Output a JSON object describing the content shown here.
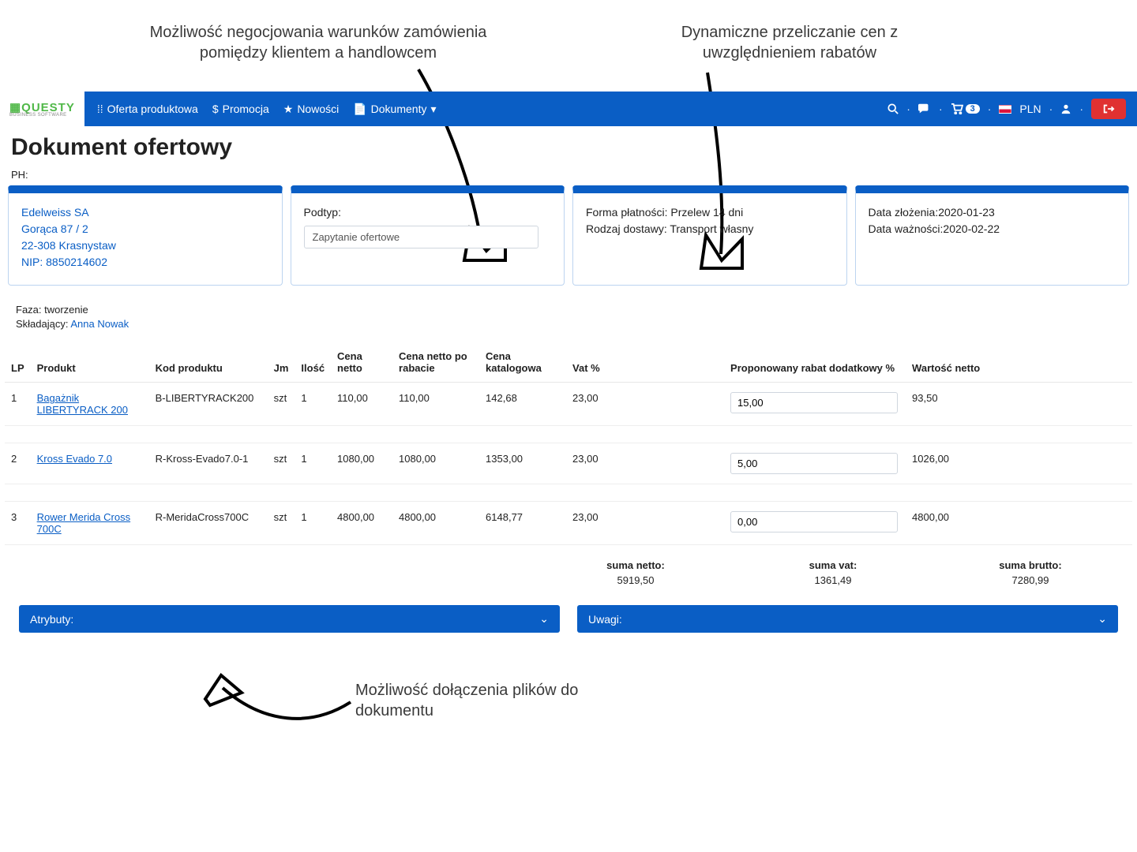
{
  "annotations": {
    "top_left": "Możliwość negocjowania warunków zamówienia pomiędzy klientem a handlowcem",
    "top_right": "Dynamiczne przeliczanie cen z uwzględnieniem rabatów",
    "bottom": "Możliwość dołączenia plików do dokumentu"
  },
  "nav": {
    "offer": "Oferta produktowa",
    "promo": "Promocja",
    "news": "Nowości",
    "docs": "Dokumenty",
    "cart_count": "3",
    "currency": "PLN"
  },
  "page": {
    "title": "Dokument ofertowy",
    "ph_label": "PH:"
  },
  "client": {
    "name": "Edelweiss SA",
    "street": "Gorąca 87 / 2",
    "city": "22-308 Krasnystaw",
    "nip_label": "NIP: 8850214602"
  },
  "subtype": {
    "label": "Podtyp:",
    "value": "Zapytanie ofertowe"
  },
  "payment": {
    "line1": "Forma płatności: Przelew 14 dni",
    "line2": "Rodzaj dostawy: Transport własny"
  },
  "dates": {
    "line1": "Data złożenia:2020-01-23",
    "line2": "Data ważności:2020-02-22"
  },
  "meta": {
    "phase": "Faza: tworzenie",
    "submitter_label": "Składający: ",
    "submitter": "Anna Nowak"
  },
  "headers": {
    "lp": "LP",
    "produkt": "Produkt",
    "kod": "Kod produktu",
    "jm": "Jm",
    "ilosc": "Ilość",
    "cena_netto": "Cena netto",
    "cena_rabat": "Cena netto po rabacie",
    "cena_kat": "Cena katalogowa",
    "vat": "Vat %",
    "prop_rabat": "Proponowany rabat dodatkowy %",
    "wartosc": "Wartość netto"
  },
  "rows": [
    {
      "lp": "1",
      "produkt": "Bagażnik LIBERTYRACK 200",
      "kod": "B-LIBERTYRACK200",
      "jm": "szt",
      "ilosc": "1",
      "cena_netto": "110,00",
      "cena_rabat": "110,00",
      "cena_kat": "142,68",
      "vat": "23,00",
      "rabat": "15,00",
      "wartosc": "93,50"
    },
    {
      "lp": "2",
      "produkt": "Kross Evado 7.0",
      "kod": "R-Kross-Evado7.0-1",
      "jm": "szt",
      "ilosc": "1",
      "cena_netto": "1080,00",
      "cena_rabat": "1080,00",
      "cena_kat": "1353,00",
      "vat": "23,00",
      "rabat": "5,00",
      "wartosc": "1026,00"
    },
    {
      "lp": "3",
      "produkt": "Rower Merida Cross 700C",
      "kod": "R-MeridaCross700C",
      "jm": "szt",
      "ilosc": "1",
      "cena_netto": "4800,00",
      "cena_rabat": "4800,00",
      "cena_kat": "6148,77",
      "vat": "23,00",
      "rabat": "0,00",
      "wartosc": "4800,00"
    }
  ],
  "totals": {
    "netto_lbl": "suma netto:",
    "netto_val": "5919,50",
    "vat_lbl": "suma vat:",
    "vat_val": "1361,49",
    "brutto_lbl": "suma brutto:",
    "brutto_val": "7280,99"
  },
  "accordions": {
    "attr": "Atrybuty:",
    "notes": "Uwagi:"
  }
}
